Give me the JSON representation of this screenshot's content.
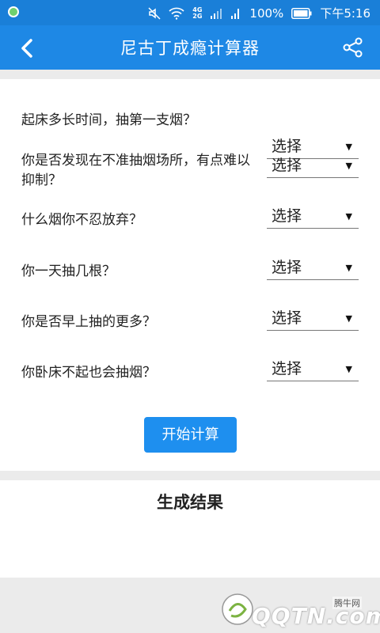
{
  "status_bar": {
    "network": "4G\n2G",
    "battery_percent": "100%",
    "time": "下午5:16"
  },
  "app_bar": {
    "title": "尼古丁成瘾计算器",
    "back_icon": "chevron-left-icon",
    "share_icon": "share-icon"
  },
  "questions": [
    {
      "label": "起床多长时间，抽第一支烟？",
      "select_value": "选择"
    },
    {
      "label": "你是否发现在不准抽烟场所，有点难以抑制？",
      "select_value": "选择"
    },
    {
      "label": "什么烟你不忍放弃？",
      "select_value": "选择"
    },
    {
      "label": "你一天抽几根？",
      "select_value": "选择"
    },
    {
      "label": "你是否早上抽的更多？",
      "select_value": "选择"
    },
    {
      "label": "你卧床不起也会抽烟？",
      "select_value": "选择"
    }
  ],
  "dropdown_arrow": "▼",
  "calculate_button": "开始计算",
  "result_title": "生成结果",
  "watermark": {
    "cn": "腾牛网",
    "en": "QQTN.com"
  },
  "colors": {
    "status_bar": "#1a7fd8",
    "app_bar": "#1e88e5",
    "button": "#1e8fef",
    "background": "#ebebeb"
  }
}
